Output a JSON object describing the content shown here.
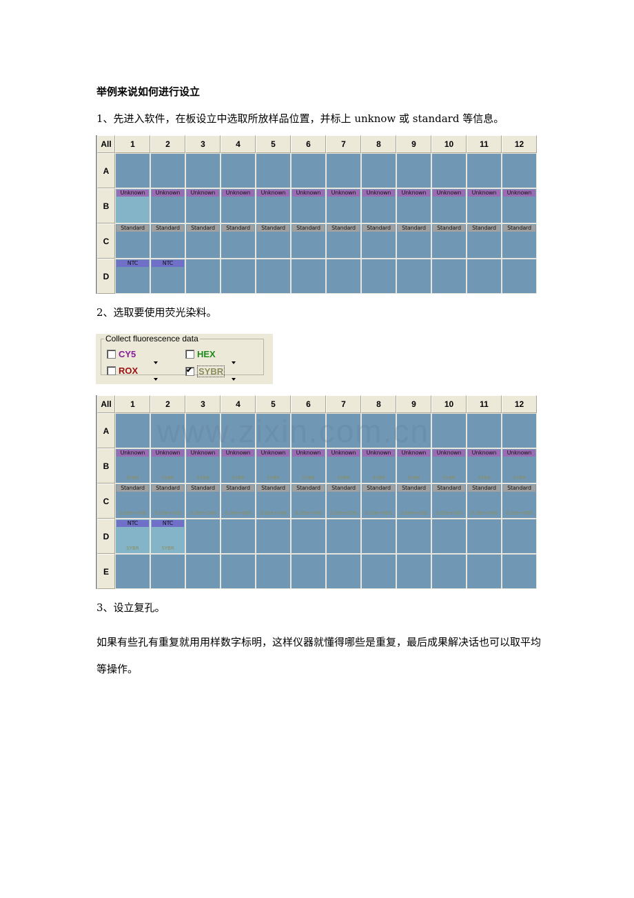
{
  "document": {
    "heading": "举例来说如何进行设立",
    "step1": "1、先进入软件，在板设立中选取所放样品位置，并标上 unknow 或 standard 等信息。",
    "step2": "2、选取要使用荧光染料。",
    "step3": "3、设立复孔。",
    "step3_body": "如果有些孔有重复就用用样数字标明，这样仪器就懂得哪些是重复，最后成果解决话也可以取平均等操作。",
    "watermark": "www.zixin.com.cn"
  },
  "plate1": {
    "corner_label": "All",
    "columns": [
      "1",
      "2",
      "3",
      "4",
      "5",
      "6",
      "7",
      "8",
      "9",
      "10",
      "11",
      "12"
    ],
    "rows": [
      {
        "label": "A",
        "wells": [
          {},
          {},
          {},
          {},
          {},
          {},
          {},
          {},
          {},
          {},
          {},
          {}
        ]
      },
      {
        "label": "B",
        "wells": [
          {
            "tag": "Unknown",
            "type": "unknown",
            "selected": true
          },
          {
            "tag": "Unknown",
            "type": "unknown"
          },
          {
            "tag": "Unknown",
            "type": "unknown"
          },
          {
            "tag": "Unknown",
            "type": "unknown"
          },
          {
            "tag": "Unknown",
            "type": "unknown"
          },
          {
            "tag": "Unknown",
            "type": "unknown"
          },
          {
            "tag": "Unknown",
            "type": "unknown"
          },
          {
            "tag": "Unknown",
            "type": "unknown"
          },
          {
            "tag": "Unknown",
            "type": "unknown"
          },
          {
            "tag": "Unknown",
            "type": "unknown"
          },
          {
            "tag": "Unknown",
            "type": "unknown"
          },
          {
            "tag": "Unknown",
            "type": "unknown"
          }
        ]
      },
      {
        "label": "C",
        "wells": [
          {
            "tag": "Standard",
            "type": "standard"
          },
          {
            "tag": "Standard",
            "type": "standard"
          },
          {
            "tag": "Standard",
            "type": "standard"
          },
          {
            "tag": "Standard",
            "type": "standard"
          },
          {
            "tag": "Standard",
            "type": "standard"
          },
          {
            "tag": "Standard",
            "type": "standard"
          },
          {
            "tag": "Standard",
            "type": "standard"
          },
          {
            "tag": "Standard",
            "type": "standard"
          },
          {
            "tag": "Standard",
            "type": "standard"
          },
          {
            "tag": "Standard",
            "type": "standard"
          },
          {
            "tag": "Standard",
            "type": "standard"
          },
          {
            "tag": "Standard",
            "type": "standard"
          }
        ]
      },
      {
        "label": "D",
        "wells": [
          {
            "tag": "NTC",
            "type": "ntc"
          },
          {
            "tag": "NTC",
            "type": "ntc"
          },
          {},
          {},
          {},
          {},
          {},
          {},
          {},
          {},
          {},
          {}
        ]
      }
    ]
  },
  "fluorescence": {
    "title": "Collect fluorescence data",
    "dyes": [
      {
        "name": "CY5",
        "checked": false,
        "color": "#8a1a9a"
      },
      {
        "name": "HEX",
        "checked": false,
        "color": "#1a8a1a"
      },
      {
        "name": "ROX",
        "checked": false,
        "color": "#9a1010"
      },
      {
        "name": "SYBR",
        "checked": true,
        "color": "#8c8c5c"
      }
    ]
  },
  "plate2": {
    "corner_label": "All",
    "columns": [
      "1",
      "2",
      "3",
      "4",
      "5",
      "6",
      "7",
      "8",
      "9",
      "10",
      "11",
      "12"
    ],
    "rows": [
      {
        "label": "A",
        "wells": [
          {},
          {},
          {},
          {},
          {},
          {},
          {},
          {},
          {},
          {},
          {},
          {}
        ]
      },
      {
        "label": "B",
        "wells": [
          {
            "tag": "Unknown",
            "type": "unknown",
            "sub": "SYBR"
          },
          {
            "tag": "Unknown",
            "type": "unknown",
            "sub": "SYBR"
          },
          {
            "tag": "Unknown",
            "type": "unknown",
            "sub": "SYBR"
          },
          {
            "tag": "Unknown",
            "type": "unknown",
            "sub": "SYBR"
          },
          {
            "tag": "Unknown",
            "type": "unknown",
            "sub": "SYBR"
          },
          {
            "tag": "Unknown",
            "type": "unknown",
            "sub": "SYBR"
          },
          {
            "tag": "Unknown",
            "type": "unknown",
            "sub": "SYBR"
          },
          {
            "tag": "Unknown",
            "type": "unknown",
            "sub": "SYBR"
          },
          {
            "tag": "Unknown",
            "type": "unknown",
            "sub": "SYBR"
          },
          {
            "tag": "Unknown",
            "type": "unknown",
            "sub": "SYBR"
          },
          {
            "tag": "Unknown",
            "type": "unknown",
            "sub": "SYBR"
          },
          {
            "tag": "Unknown",
            "type": "unknown",
            "sub": "SYBR"
          }
        ]
      },
      {
        "label": "C",
        "wells": [
          {
            "tag": "Standard",
            "type": "standard",
            "sub": "0.00e+000"
          },
          {
            "tag": "Standard",
            "type": "standard",
            "sub": "0.00e+000"
          },
          {
            "tag": "Standard",
            "type": "standard",
            "sub": "0.00e+000"
          },
          {
            "tag": "Standard",
            "type": "standard",
            "sub": "0.00e+000"
          },
          {
            "tag": "Standard",
            "type": "standard",
            "sub": "0.00e+000"
          },
          {
            "tag": "Standard",
            "type": "standard",
            "sub": "0.00e+000"
          },
          {
            "tag": "Standard",
            "type": "standard",
            "sub": "0.00e+000"
          },
          {
            "tag": "Standard",
            "type": "standard",
            "sub": "0.00e+000"
          },
          {
            "tag": "Standard",
            "type": "standard",
            "sub": "0.00e+000"
          },
          {
            "tag": "Standard",
            "type": "standard",
            "sub": "0.00e+000"
          },
          {
            "tag": "Standard",
            "type": "standard",
            "sub": "0.00e+000"
          },
          {
            "tag": "Standard",
            "type": "standard",
            "sub": "0.00e+000"
          }
        ]
      },
      {
        "label": "D",
        "wells": [
          {
            "tag": "NTC",
            "type": "ntc",
            "sub": "SYBR",
            "selected": true
          },
          {
            "tag": "NTC",
            "type": "ntc",
            "sub": "SYBR",
            "selected": true
          },
          {},
          {},
          {},
          {},
          {},
          {},
          {},
          {},
          {},
          {}
        ]
      },
      {
        "label": "E",
        "wells": [
          {},
          {},
          {},
          {},
          {},
          {},
          {},
          {},
          {},
          {},
          {},
          {}
        ]
      }
    ]
  }
}
